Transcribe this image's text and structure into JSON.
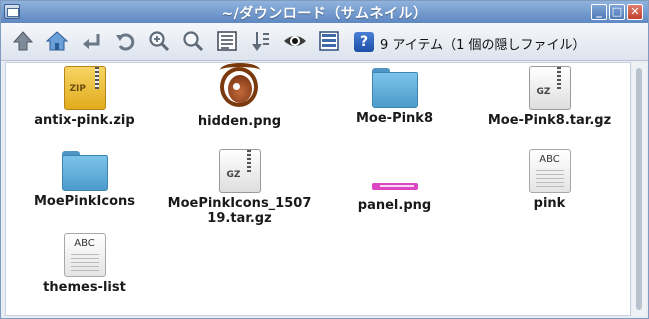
{
  "window": {
    "title": "~/ダウンロード（サムネイル）",
    "min_symbol": "_",
    "max_symbol": "□",
    "close_symbol": "✕"
  },
  "toolbar": {
    "icons": [
      "up-icon",
      "home-icon",
      "back-enter-icon",
      "undo-icon",
      "zoom-in-icon",
      "zoom-out-icon",
      "details-view-icon",
      "sort-icon",
      "eye-icon",
      "list-view-icon",
      "help-icon"
    ],
    "help_label": "?",
    "status": "9 アイテム（1 個の隠しファイル）"
  },
  "files": [
    {
      "name": "antix-pink.zip",
      "icon": "zip-archive-icon",
      "type_label": "ZIP"
    },
    {
      "name": "hidden.png",
      "icon": "eye-image-icon"
    },
    {
      "name": "Moe-Pink8",
      "icon": "folder-icon"
    },
    {
      "name": "Moe-Pink8.tar.gz",
      "icon": "gz-archive-icon",
      "type_label": "GZ"
    },
    {
      "name": "MoePinkIcons",
      "icon": "folder-icon"
    },
    {
      "name": "MoePinkIcons_150719.tar.gz",
      "icon": "gz-archive-icon",
      "type_label": "GZ"
    },
    {
      "name": "panel.png",
      "icon": "pink-bar-image-icon"
    },
    {
      "name": "pink",
      "icon": "text-file-icon",
      "type_label": "ABC"
    },
    {
      "name": "themes-list",
      "icon": "text-file-icon",
      "type_label": "ABC"
    }
  ],
  "colors": {
    "titlebar": "#6f96cc",
    "folder": "#5ea9d6",
    "zip": "#f0c03a",
    "panel_png": "#dd46c3"
  }
}
